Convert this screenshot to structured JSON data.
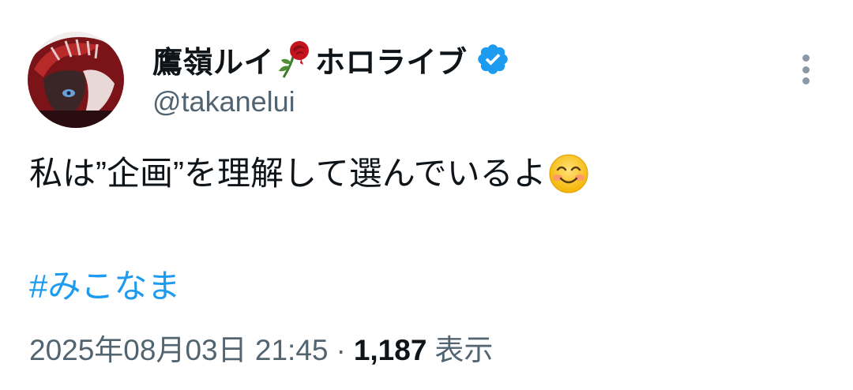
{
  "author": {
    "display_name": "鷹嶺ルイ",
    "affiliation": "ホロライブ",
    "handle": "@takanelui",
    "name_icon": "rose-icon",
    "verified_icon": "verified-badge-icon",
    "verified_color": "#1d9bf0"
  },
  "menu": {
    "icon": "more-vertical-icon"
  },
  "tweet": {
    "text": "私は”企画”を理解して選んでいるよ",
    "emoji": "smiling-face-icon",
    "hashtag": "#みこなま"
  },
  "meta": {
    "date_time": "2025年08月03日 21:45",
    "separator": "·",
    "views_count": "1,187",
    "views_label": "表示"
  },
  "colors": {
    "text": "#0f1419",
    "secondary": "#536471",
    "link": "#1d9bf0",
    "background": "#ffffff"
  }
}
